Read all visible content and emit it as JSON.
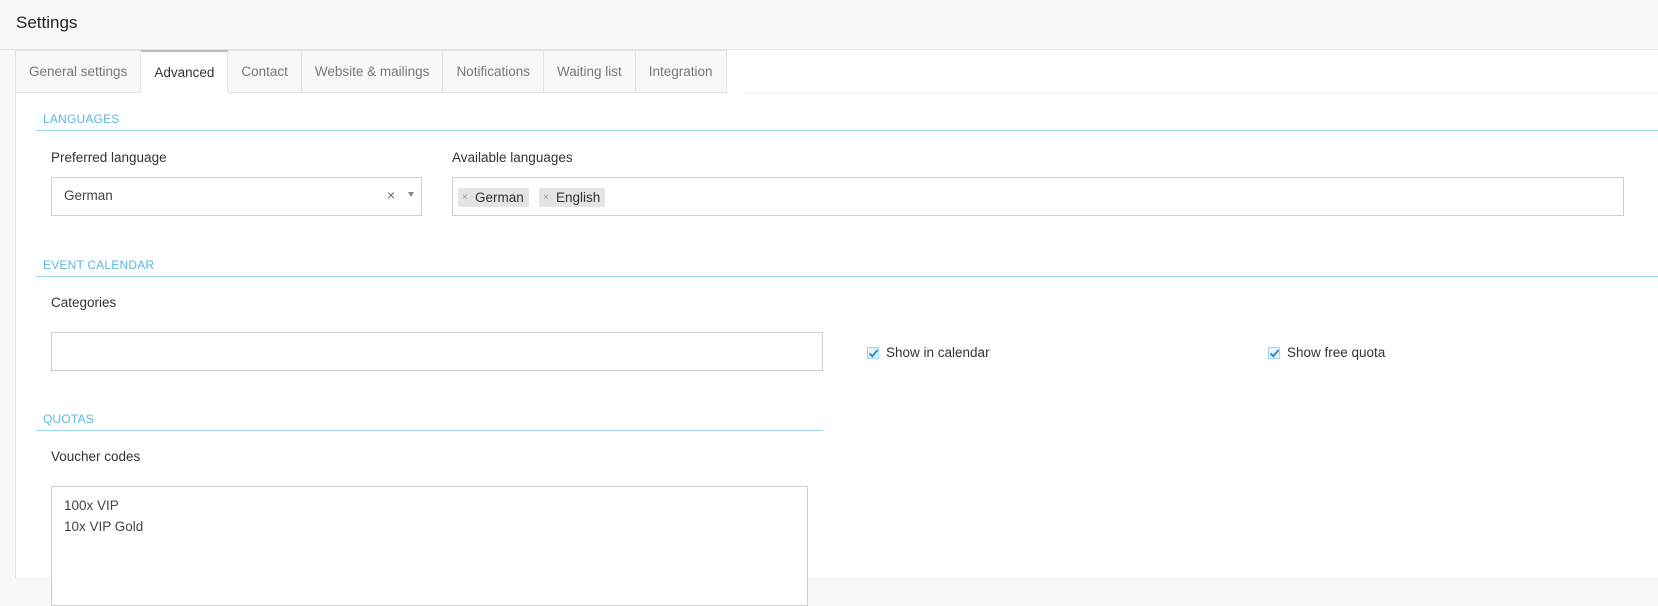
{
  "page": {
    "title": "Settings"
  },
  "tabs": [
    {
      "label": "General settings",
      "active": false
    },
    {
      "label": "Advanced",
      "active": true
    },
    {
      "label": "Contact",
      "active": false
    },
    {
      "label": "Website & mailings",
      "active": false
    },
    {
      "label": "Notifications",
      "active": false
    },
    {
      "label": "Waiting list",
      "active": false
    },
    {
      "label": "Integration",
      "active": false
    }
  ],
  "languages": {
    "section_title": "LANGUAGES",
    "preferred_label": "Preferred language",
    "preferred_value": "German",
    "clear_symbol": "×",
    "available_label": "Available languages",
    "available_tags": [
      "German",
      "English"
    ],
    "tag_remove_symbol": "×"
  },
  "event_calendar": {
    "section_title": "EVENT CALENDAR",
    "categories_label": "Categories",
    "categories_value": "",
    "show_in_calendar_label": "Show in calendar",
    "show_in_calendar_checked": true,
    "show_free_quota_label": "Show free quota",
    "show_free_quota_checked": true
  },
  "quotas": {
    "section_title": "QUOTAS",
    "voucher_label": "Voucher codes",
    "voucher_lines": [
      "100x VIP",
      "10x VIP Gold"
    ]
  },
  "colors": {
    "accent": "#5bb7e5",
    "section_line": "#9fd6ef",
    "border": "#cfcfcf",
    "tag_bg": "#e4e4e4"
  }
}
